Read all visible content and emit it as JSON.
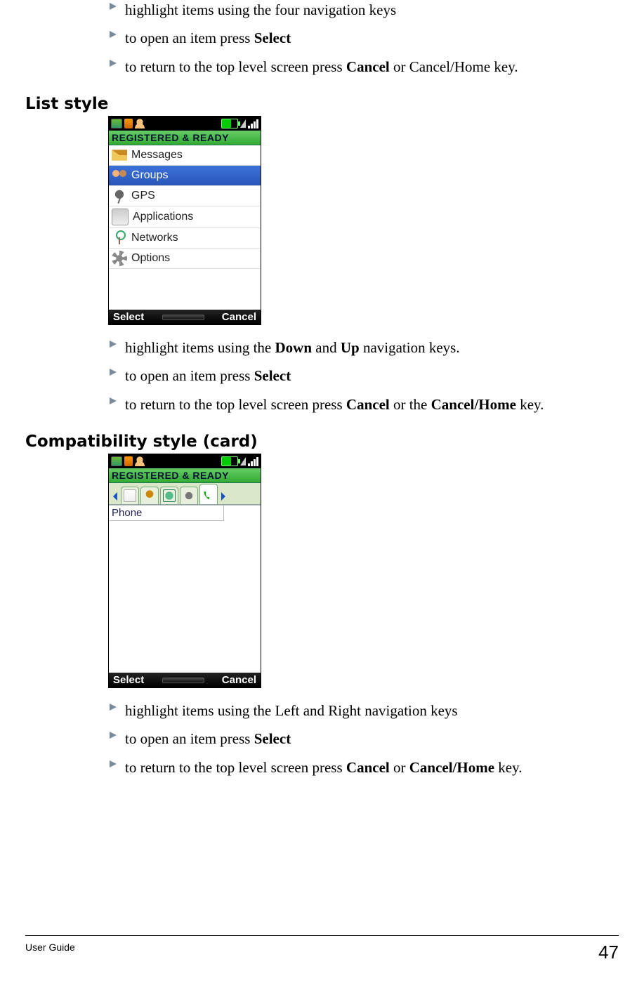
{
  "topList": {
    "items": [
      {
        "html": "highlight items using the four navigation keys"
      },
      {
        "html": "to open an item press <b>Select</b>"
      },
      {
        "html": "to return to the top level screen press <b>Cancel</b> or Cancel/Home key."
      }
    ]
  },
  "section1": {
    "heading": "List style",
    "phone": {
      "regReady": "REGISTERED & READY",
      "menu": [
        "Messages",
        "Groups",
        "GPS",
        "Applications",
        "Networks",
        "Options"
      ],
      "selectedIndex": 1,
      "softLeft": "Select",
      "softRight": "Cancel"
    },
    "bullets": [
      {
        "html": "highlight items using the <b>Down</b> and <b>Up</b> navigation keys."
      },
      {
        "html": "to open an item press <b>Select</b>"
      },
      {
        "html": "to return to the top level screen press <b>Cancel</b> or the <b>Cancel/Home</b> key."
      }
    ]
  },
  "section2": {
    "heading": "Compatibility style (card)",
    "phone": {
      "regReady": "REGISTERED & READY",
      "tabs": [
        "notes",
        "people",
        "globe",
        "gear",
        "phone"
      ],
      "activeTabIndex": 4,
      "fieldLabel": "Phone",
      "softLeft": "Select",
      "softRight": "Cancel"
    },
    "bullets": [
      {
        "html": "highlight items using the Left and Right navigation keys"
      },
      {
        "html": "to open an item press <b>Select</b>"
      },
      {
        "html": "to return to the top level screen press <b>Cancel</b> or <b>Cancel/Home</b> key."
      }
    ]
  },
  "footer": {
    "left": "User Guide",
    "pageNo": "47"
  }
}
